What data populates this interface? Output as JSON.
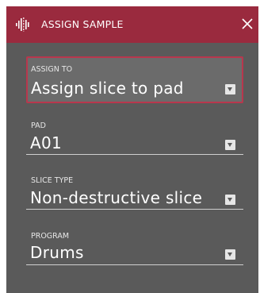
{
  "dialog": {
    "title": "ASSIGN SAMPLE",
    "title_icon": "slice-waveform-icon",
    "close_icon": "close-icon",
    "colors": {
      "titlebar": "#9a2a3e",
      "body": "#5a5a5a",
      "selected_border": "#b8374d"
    }
  },
  "fields": [
    {
      "label": "ASSIGN TO",
      "value": "Assign slice to pad"
    },
    {
      "label": "PAD",
      "value": "A01"
    },
    {
      "label": "SLICE TYPE",
      "value": "Non-destructive slice"
    },
    {
      "label": "PROGRAM",
      "value": "Drums"
    }
  ]
}
